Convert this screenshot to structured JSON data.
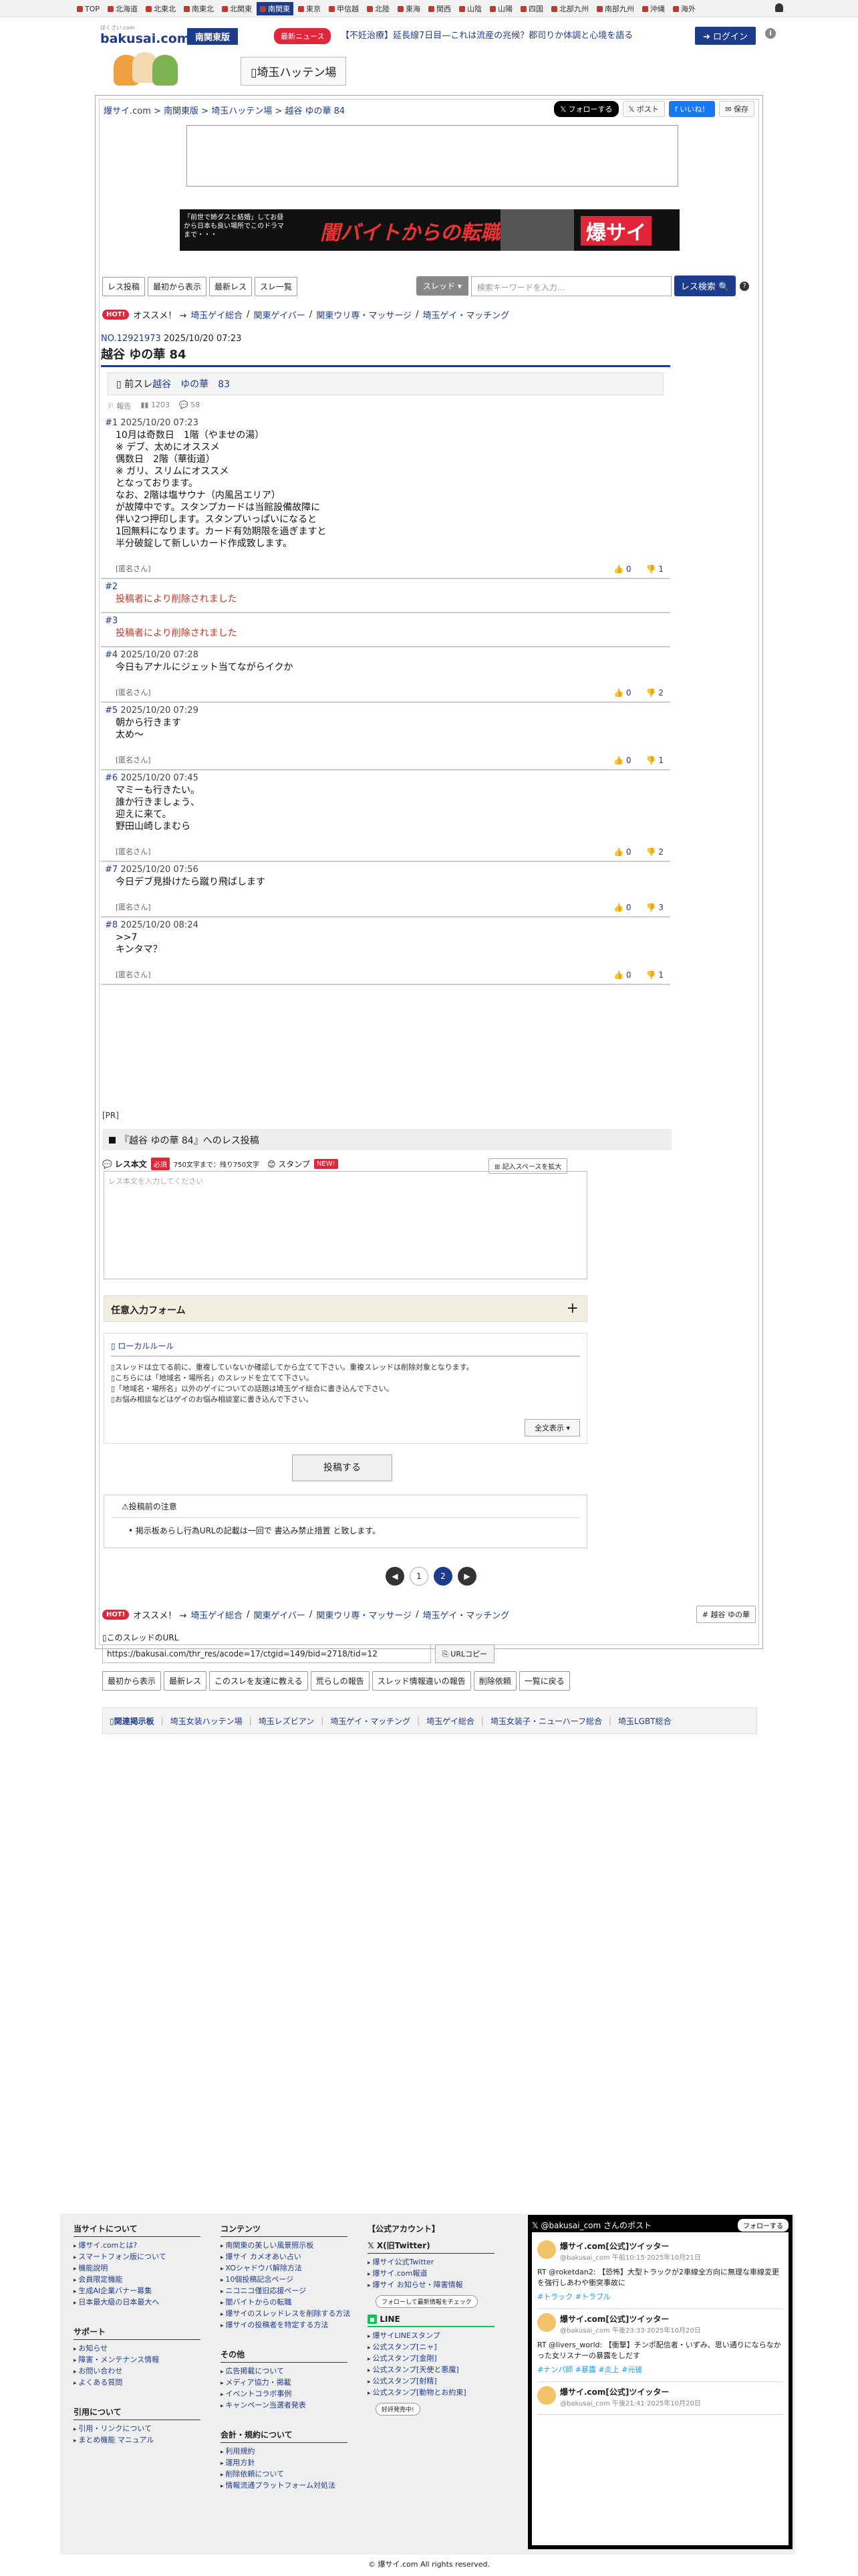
{
  "regions": [
    "TOP",
    "北海道",
    "北東北",
    "南東北",
    "北関東",
    "南関東",
    "東京",
    "甲信越",
    "北陸",
    "東海",
    "関西",
    "山陰",
    "山陽",
    "四国",
    "北部九州",
    "南部九州",
    "沖縄",
    "海外"
  ],
  "header": {
    "logo_sub": "ばくさい.com",
    "logo_main": "bakusai.com",
    "region_badge": "南関東版",
    "news_label": "最新ニュース",
    "news_text": "【不妊治療】延長線7日目—これは流産の兆候？郡司りか体調と心境を語る",
    "login": "ログイン",
    "board_name": "埼玉ハッテン場"
  },
  "breadcrumb": "爆サイ.com > 南関東版 > 埼玉ハッテン場 > 越谷 ゆの華 84",
  "share": {
    "x_follow": "フォローする",
    "x_post": "ポスト",
    "fb": "いいね！",
    "save": "保存"
  },
  "ad": {
    "left_text": "「前世で姉ダスと結婚」してお昼から日本も良い場所でこのドラマまで・・・",
    "main": "闇バイトからの転職",
    "brand": "爆サイ"
  },
  "toolbar": {
    "buttons": [
      "レス投稿",
      "最初から表示",
      "最新レス",
      "スレ一覧"
    ],
    "search_scope": "スレッド",
    "search_placeholder": "検索キーワードを入力...",
    "search_button": "レス検索"
  },
  "hot": {
    "label": "HOT!",
    "lead": "オススメ！ →",
    "links": [
      "埼玉ゲイ総合",
      "関東ゲイバー",
      "関東ウリ専・マッサージ",
      "埼玉ゲイ・マッチング"
    ]
  },
  "thread": {
    "id": "NO.12921973",
    "date": "2025/10/20 07:23",
    "title": "越谷 ゆの華 84",
    "prev_label": "前スレ",
    "prev_link": "越谷　ゆの華　83",
    "stats": {
      "report": "報告",
      "views": "1203",
      "comments": "58"
    }
  },
  "posts": [
    {
      "no": "#1",
      "date": "2025/10/20 07:23",
      "body": "10月は奇数日　1階（やませの湯）\n※ デブ、太めにオススメ\n偶数日　2階（華街道）\n※ ガリ、スリムにオススメ\nとなっております。\nなお、2階は塩サウナ（内風呂エリア）\nが故障中です。スタンプカードは当館設備故障に\n伴い2つ押印します。スタンプいっぱいになると\n1回無料になります。カード有効期限を過ぎますと\n半分破錠して新しいカード作成致します。",
      "name": "[匿名さん]",
      "up": "0",
      "down": "1",
      "deleted": false
    },
    {
      "no": "#2",
      "date": "",
      "body": "投稿者により削除されました",
      "name": "",
      "up": "",
      "down": "",
      "deleted": true
    },
    {
      "no": "#3",
      "date": "",
      "body": "投稿者により削除されました",
      "name": "",
      "up": "",
      "down": "",
      "deleted": true
    },
    {
      "no": "#4",
      "date": "2025/10/20 07:28",
      "body": "今日もアナルにジェット当てながらイクか",
      "name": "[匿名さん]",
      "up": "0",
      "down": "2",
      "deleted": false
    },
    {
      "no": "#5",
      "date": "2025/10/20 07:29",
      "body": "朝から行きます\n太め〜",
      "name": "[匿名さん]",
      "up": "0",
      "down": "1",
      "deleted": false
    },
    {
      "no": "#6",
      "date": "2025/10/20 07:45",
      "body": "マミーも行きたい。\n誰か行きましょう、\n迎えに来て。\n野田山崎しまむら",
      "name": "[匿名さん]",
      "up": "0",
      "down": "2",
      "deleted": false
    },
    {
      "no": "#7",
      "date": "2025/10/20 07:56",
      "body": "今日デブ見掛けたら蹴り飛ばします",
      "name": "[匿名さん]",
      "up": "0",
      "down": "3",
      "deleted": false
    },
    {
      "no": "#8",
      "date": "2025/10/20 08:24",
      "body": ">>7\nキンタマ？",
      "name": "[匿名さん]",
      "up": "0",
      "down": "1",
      "deleted": false
    }
  ],
  "form": {
    "pr": "[PR]",
    "heading": "『越谷 ゆの華 84』へのレス投稿",
    "body_label": "レス本文",
    "required": "必須",
    "limit": "750文字まで：残り750文字",
    "stamp": "スタンプ",
    "new": "NEW!",
    "expand": "記入スペースを拡大",
    "placeholder": "レス本文を入力してください",
    "optional": "任意入力フォーム",
    "rules_title": "ローカルルール",
    "rules": [
      "スレッドは立てる前に、重複していないか確認してから立てて下さい。重複スレッドは削除対象となります。",
      "こちらには「地域名・場所名」のスレッドを立てて下さい。",
      "「地域名・場所名」以外のゲイについての話題は埼玉ゲイ総合に書き込んで下さい。",
      "お悩み相談などはゲイのお悩み相談室に書き込んで下さい。"
    ],
    "rules_more": "全文表示",
    "submit": "投稿する",
    "notice_title": "投稿前の注意",
    "notice_body": "掲示板あらし行為URLの記載は一回で 書込み禁止措置 と致します。"
  },
  "pager": [
    "1",
    "2"
  ],
  "bookmark": "越谷 ゆの華",
  "url_label": "このスレッドのURL",
  "url_value": "https://bakusai.com/thr_res/acode=17/ctgid=149/bid=2718/tid=12",
  "url_copy": "URLコピー",
  "actions": [
    "最初から表示",
    "最新レス",
    "このスレを友達に教える",
    "荒らしの報告",
    "スレッド情報違いの報告",
    "削除依頼",
    "一覧に戻る"
  ],
  "related": {
    "head": "関連掲示板",
    "links": [
      "埼玉女装ハッテン場",
      "埼玉レズビアン",
      "埼玉ゲイ・マッチング",
      "埼玉ゲイ総合",
      "埼玉女装子・ニューハーフ総合",
      "埼玉LGBT総合"
    ]
  },
  "footer": {
    "about_title": "当サイトについて",
    "about": [
      "爆サイ.comとは?",
      "スマートフォン版について",
      "機能説明",
      "会員限定機能",
      "生成AI企業バナー募集",
      "日本最大級の日本最大へ"
    ],
    "support_title": "サポート",
    "support": [
      "お知らせ",
      "障害・メンテナンス情報",
      "お問い合わせ",
      "よくある質問"
    ],
    "cite_title": "引用について",
    "cite": [
      "引用・リンクについて",
      "まとめ機能 マニュアル"
    ],
    "contents_title": "コンテンツ",
    "contents": [
      "南関東の美しい風景照示板",
      "爆サイ カメオあい占い",
      "XOシャドウバ解除方法",
      "10個投稿記念ページ",
      "ニコニコ僅旧応援ページ",
      "闇バイトからの転職",
      "爆サイのスレッドレスを削除する方法",
      "爆サイの投稿者を特定する方法"
    ],
    "other_title": "その他",
    "other": [
      "広告掲載について",
      "メディア協力・掲載",
      "イベントコラボ事例",
      "キャンペーン当選者発表"
    ],
    "terms_title": "会計・規約について",
    "terms": [
      "利用規約",
      "運用方針",
      "削除依頼について",
      "情報流通プラットフォーム対処法"
    ],
    "official_title": "【公式アカウント】",
    "x_title": "X(旧Twitter)",
    "x_links": [
      "爆サイ公式Twitter",
      "爆サイ.com報道",
      "爆サイ お知らせ・障害情報"
    ],
    "x_follow_btn": "フォローして最新情報をチェック",
    "line_title": "LINE",
    "line_links": [
      "爆サイLINEスタンプ",
      "公式スタンプ[ニャ]",
      "公式スタンプ[金剛]",
      "公式スタンプ[天使と悪魔]",
      "公式スタンプ[射精]",
      "公式スタンプ[動物とお約束]"
    ],
    "line_more": "好評発売中!",
    "x_panel_title": "@bakusai_com さんのポスト",
    "x_panel_follow": "フォローする",
    "tweets": [
      {
        "name": "爆サイ.com[公式]ツイッター",
        "meta": "@bakusai_com 午前10:15·2025年10月21日",
        "text": "RT @roketdan2: 【恐怖】大型トラックが2車線全方向に無理な車線変更を強行しあわや衝突事故に",
        "tags": "#トラック #トラブル"
      },
      {
        "name": "爆サイ.com[公式]ツイッター",
        "meta": "@bakusai_com 午後23:33·2025年10月20日",
        "text": "RT @livers_world: 【衝撃】チンポ配信者・いずみ、思い通りにならなかった女リスナーの暴露をしだす",
        "tags": "#ナンパ師 #暴露 #炎上 #元彼"
      },
      {
        "name": "爆サイ.com[公式]ツイッター",
        "meta": "@bakusai_com 午後21:41·2025年10月20日",
        "text": "",
        "tags": ""
      }
    ]
  },
  "copyright": "© 爆サイ.com All rights reserved."
}
